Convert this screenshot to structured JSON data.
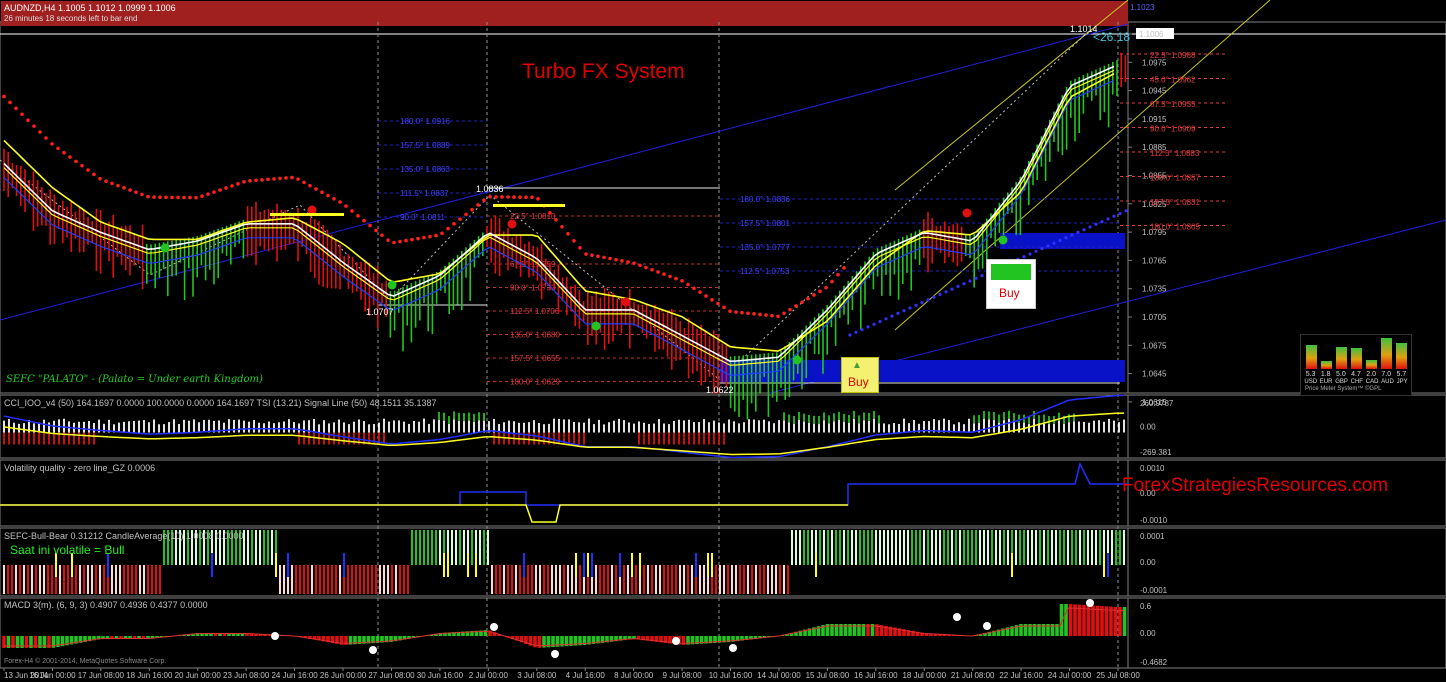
{
  "window": {
    "header": "AUDNZD,H4  1.1005 1.1012 1.0999 1.1006",
    "countdown": "26 minutes 18 seconds left to bar end"
  },
  "overlay": {
    "title": "Turbo FX System",
    "watermark": "ForexStrategiesResources.com",
    "indicator_name": "SEFC \"PALATO\" - (Palato = Under earth Kingdom)",
    "pips_label": "<26.18",
    "high_label": "1.1014",
    "low_labels": [
      "1.0707",
      "1.0622"
    ],
    "swing_label": "1.0836",
    "buy_labels": [
      "Buy",
      "Buy"
    ],
    "top_right_price": "1.1023"
  },
  "price_axis": {
    "current": "1.1006",
    "ticks": [
      "1.1006",
      "1.0975",
      "1.0945",
      "1.0915",
      "1.0885",
      "1.0855",
      "1.0825",
      "1.0795",
      "1.0765",
      "1.0735",
      "1.0705",
      "1.0675",
      "1.0645",
      "1.0615"
    ]
  },
  "fib_right": [
    {
      "label": "22.5° 1.0988",
      "color": "#e03a3a"
    },
    {
      "label": "45.0° 1.0962",
      "color": "#e03a3a"
    },
    {
      "label": "67.5° 1.0935",
      "color": "#e03a3a"
    },
    {
      "label": "90.0° 1.0909",
      "color": "#e03a3a"
    },
    {
      "label": "112.5° 1.0883",
      "color": "#e03a3a"
    },
    {
      "label": "135.0° 1.0857",
      "color": "#e03a3a"
    },
    {
      "label": "157.5° 1.0831",
      "color": "#e03a3a"
    },
    {
      "label": "180.0° 1.0805",
      "color": "#e03a3a"
    }
  ],
  "fib_mid_blue": [
    "180.0° 1.0836",
    "157.5° 1.0801",
    "135.0° 1.0777",
    "112.5° 1.0753"
  ],
  "fib_left_blue": [
    "180.0° 1.0916",
    "157.5° 1.0889",
    "135.0° 1.0863",
    "111.5° 1.0837",
    "90.0° 1.0811"
  ],
  "fib_mid_red": [
    "67.5° 1.0759",
    "90.0° 1.0733",
    "112.5° 1.0706",
    "135.0° 1.0680",
    "157.5° 1.0655",
    "180.0° 1.0629"
  ],
  "fib_red_top": "22.5° 1.0810",
  "price_meter": {
    "name": "Price Meter System™ ©GPL",
    "values": [
      "5.3",
      "1.8",
      "5.0",
      "4.7",
      "2.0",
      "7.0",
      "5.7"
    ],
    "currencies": [
      "USD",
      "EUR",
      "GBP",
      "CHF",
      "CAD",
      "AUD",
      "JPY"
    ]
  },
  "panes": {
    "cci": {
      "label": "CCI_IOO_v4 (50) 164.1697 0.0000 100.0000 0.0000 164.1697  TSI (13.21) Signal Line (50) 48.1511 35.1387",
      "ticks": [
        "260.9787",
        "0.00",
        "-269.381"
      ]
    },
    "vq": {
      "label": "Volatility quality - zero line_GZ 0.0006",
      "ticks": [
        "0.0010",
        "0.00",
        "-0.0010"
      ]
    },
    "bb": {
      "label": "SEFC-Bull-Bear 0.31212  CandleAverage(10) 1.0008 0.0000",
      "status": "Saat ini volatile = Bull",
      "ticks": [
        "0.0001",
        "0.00",
        "-0.0001"
      ]
    },
    "macd": {
      "label": "MACD 3(m). (6, 9, 3) 0.4907 0.4936 0.4377 0.0000",
      "ticks": [
        "0.6",
        "0.00",
        "-0.4682"
      ],
      "copyright": "Forex-H4 © 2001-2014, MetaQuotes Software Corp."
    }
  },
  "time_axis": [
    "13 Jun 2014",
    "16 Jun 00:00",
    "17 Jun 08:00",
    "18 Jun 16:00",
    "20 Jun 00:00",
    "23 Jun 08:00",
    "24 Jun 16:00",
    "26 Jun 00:00",
    "27 Jun 08:00",
    "30 Jun 16:00",
    "2 Jul 00:00",
    "3 Jul 08:00",
    "4 Jul 16:00",
    "8 Jul 00:00",
    "9 Jul 08:00",
    "10 Jul 16:00",
    "14 Jul 00:00",
    "15 Jul 08:00",
    "16 Jul 16:00",
    "18 Jul 00:00",
    "21 Jul 08:00",
    "22 Jul 16:00",
    "24 Jul 00:00",
    "25 Jul 08:00"
  ],
  "colors": {
    "bull": "#22c422",
    "bear": "#e01010",
    "blue": "#1a1acc",
    "yellow": "#ffff22",
    "white": "#ffffff",
    "header_band": "#a02020"
  },
  "chart_data": {
    "type": "line",
    "title": "Turbo FX System",
    "symbol": "AUDNZD,H4",
    "x": [
      "13 Jun 2014",
      "16 Jun 00:00",
      "17 Jun 08:00",
      "18 Jun 16:00",
      "20 Jun 00:00",
      "23 Jun 08:00",
      "24 Jun 16:00",
      "26 Jun 00:00",
      "27 Jun 08:00",
      "30 Jun 16:00",
      "2 Jul 00:00",
      "3 Jul 08:00",
      "4 Jul 16:00",
      "8 Jul 00:00",
      "9 Jul 08:00",
      "10 Jul 16:00",
      "14 Jul 00:00",
      "15 Jul 08:00",
      "16 Jul 16:00",
      "18 Jul 00:00",
      "21 Jul 08:00",
      "22 Jul 16:00",
      "24 Jul 00:00",
      "25 Jul 08:00"
    ],
    "series": [
      {
        "values": [
          1.087,
          1.0815,
          1.079,
          1.077,
          1.078,
          1.08,
          1.08,
          1.0755,
          1.0715,
          1.074,
          1.079,
          1.076,
          1.07,
          1.07,
          1.067,
          1.064,
          1.0645,
          1.07,
          1.0765,
          1.079,
          1.078,
          1.085,
          1.096,
          1.0985
        ]
      },
      {
        "values": [
          1.089,
          1.0835,
          1.0795,
          1.0775,
          1.0775,
          1.0795,
          1.08,
          1.077,
          1.0725,
          1.0735,
          1.078,
          1.078,
          1.0715,
          1.0705,
          1.0685,
          1.065,
          1.0645,
          1.068,
          1.0745,
          1.0785,
          1.078,
          1.083,
          1.094,
          1.097
        ]
      }
    ],
    "ylim": [
      1.0615,
      1.1023
    ]
  }
}
